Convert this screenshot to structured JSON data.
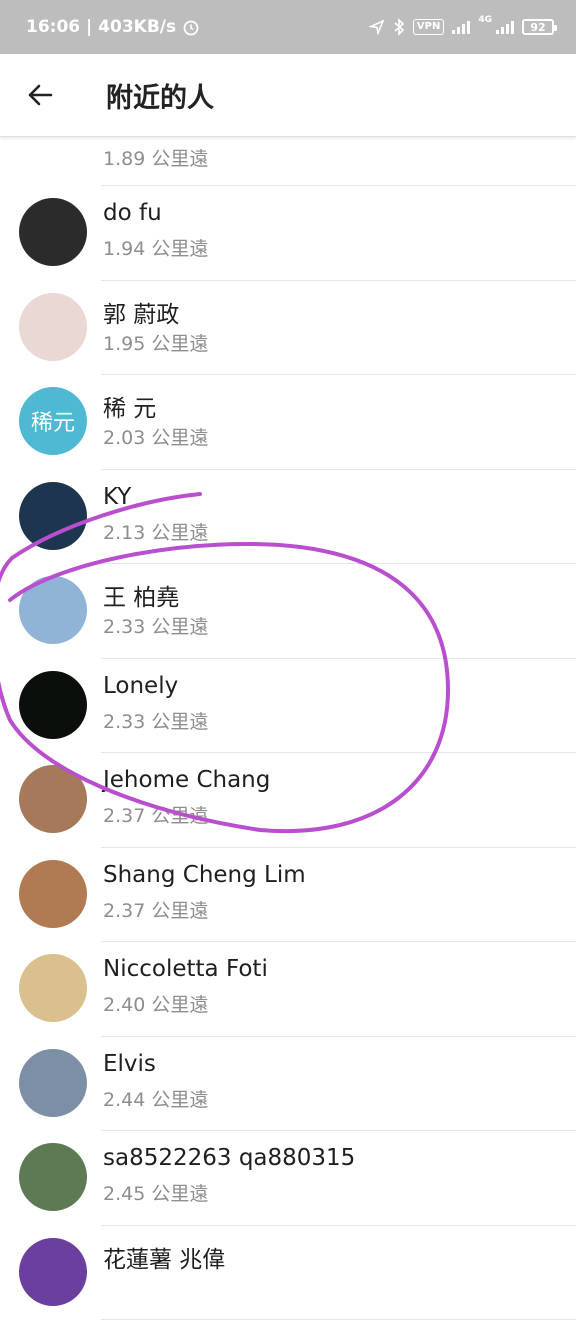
{
  "status_bar": {
    "time_speed": "16:06 | 403KB/s",
    "vpn": "VPN",
    "network": "4G",
    "battery": "92"
  },
  "header": {
    "title": "附近的人"
  },
  "people": [
    {
      "name": "",
      "distance": "1.89 公里遠",
      "avatar_color": "#8a6b55",
      "avatar_text": ""
    },
    {
      "name": "do fu",
      "distance": "1.94 公里遠",
      "avatar_color": "#2b2b2b",
      "avatar_text": ""
    },
    {
      "name": "郭 蔚政",
      "distance": "1.95 公里遠",
      "avatar_color": "#e9d8d4",
      "avatar_text": ""
    },
    {
      "name": "稀 元",
      "distance": "2.03 公里遠",
      "avatar_color": "#4fb9d4",
      "avatar_text": "稀元"
    },
    {
      "name": "KY",
      "distance": "2.13 公里遠",
      "avatar_color": "#1e3550",
      "avatar_text": ""
    },
    {
      "name": "王 柏堯",
      "distance": "2.33 公里遠",
      "avatar_color": "#8fb4d6",
      "avatar_text": ""
    },
    {
      "name": "Lonely",
      "distance": "2.33 公里遠",
      "avatar_color": "#0b0f0b",
      "avatar_text": ""
    },
    {
      "name": "Jehome Chang",
      "distance": "2.37 公里遠",
      "avatar_color": "#a5795a",
      "avatar_text": ""
    },
    {
      "name": "Shang Cheng Lim",
      "distance": "2.37 公里遠",
      "avatar_color": "#b07a52",
      "avatar_text": ""
    },
    {
      "name": "Niccoletta Foti",
      "distance": "2.40 公里遠",
      "avatar_color": "#d9c08e",
      "avatar_text": ""
    },
    {
      "name": "Elvis",
      "distance": "2.44 公里遠",
      "avatar_color": "#7d8fa6",
      "avatar_text": ""
    },
    {
      "name": "sa8522263 qa880315",
      "distance": "2.45 公里遠",
      "avatar_color": "#5e7a55",
      "avatar_text": ""
    },
    {
      "name": "花蓮薯 兆偉",
      "distance": "",
      "avatar_color": "#6b3fa0",
      "avatar_text": ""
    }
  ],
  "colors": {
    "annotation": "#b94fcf",
    "status_bar": "#bdbdbd"
  }
}
